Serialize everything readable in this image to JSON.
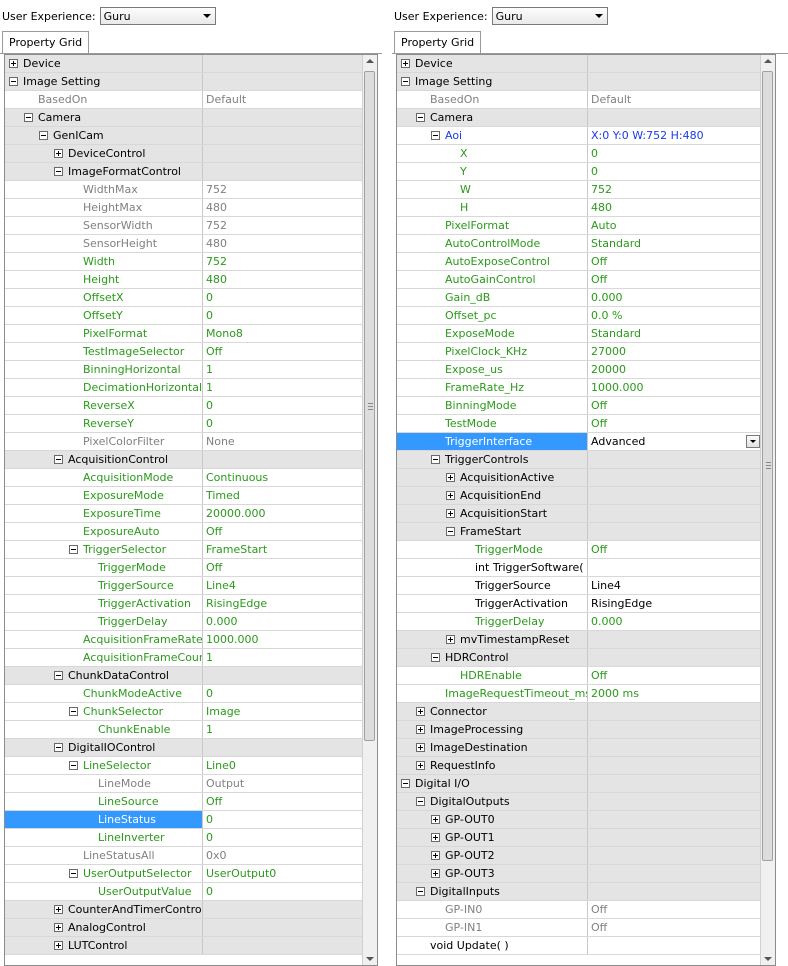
{
  "left": {
    "ux_label": "User Experience:",
    "ux_value": "Guru",
    "tab": "Property Grid",
    "rows": [
      {
        "depth": 0,
        "exp": "plus",
        "label": "Device",
        "value": "",
        "color": "black",
        "cat": true
      },
      {
        "depth": 0,
        "exp": "minus",
        "label": "Image Setting",
        "value": "",
        "color": "black",
        "cat": true
      },
      {
        "depth": 1,
        "exp": "none",
        "label": "BasedOn",
        "value": "Default",
        "color": "gray"
      },
      {
        "depth": 1,
        "exp": "minus",
        "label": "Camera",
        "value": "",
        "color": "black",
        "cat": true
      },
      {
        "depth": 2,
        "exp": "minus",
        "label": "GenICam",
        "value": "",
        "color": "black",
        "cat": true
      },
      {
        "depth": 3,
        "exp": "plus",
        "label": "DeviceControl",
        "value": "",
        "color": "black",
        "cat": true
      },
      {
        "depth": 3,
        "exp": "minus",
        "label": "ImageFormatControl",
        "value": "",
        "color": "black",
        "cat": true
      },
      {
        "depth": 4,
        "exp": "none",
        "label": "WidthMax",
        "value": "752",
        "color": "gray"
      },
      {
        "depth": 4,
        "exp": "none",
        "label": "HeightMax",
        "value": "480",
        "color": "gray"
      },
      {
        "depth": 4,
        "exp": "none",
        "label": "SensorWidth",
        "value": "752",
        "color": "gray"
      },
      {
        "depth": 4,
        "exp": "none",
        "label": "SensorHeight",
        "value": "480",
        "color": "gray"
      },
      {
        "depth": 4,
        "exp": "none",
        "label": "Width",
        "value": "752",
        "color": "green"
      },
      {
        "depth": 4,
        "exp": "none",
        "label": "Height",
        "value": "480",
        "color": "green"
      },
      {
        "depth": 4,
        "exp": "none",
        "label": "OffsetX",
        "value": "0",
        "color": "green"
      },
      {
        "depth": 4,
        "exp": "none",
        "label": "OffsetY",
        "value": "0",
        "color": "green"
      },
      {
        "depth": 4,
        "exp": "none",
        "label": "PixelFormat",
        "value": "Mono8",
        "color": "green"
      },
      {
        "depth": 4,
        "exp": "none",
        "label": "TestImageSelector",
        "value": "Off",
        "color": "green"
      },
      {
        "depth": 4,
        "exp": "none",
        "label": "BinningHorizontal",
        "value": "1",
        "color": "green"
      },
      {
        "depth": 4,
        "exp": "none",
        "label": "DecimationHorizontal",
        "value": "1",
        "color": "green"
      },
      {
        "depth": 4,
        "exp": "none",
        "label": "ReverseX",
        "value": "0",
        "color": "green"
      },
      {
        "depth": 4,
        "exp": "none",
        "label": "ReverseY",
        "value": "0",
        "color": "green"
      },
      {
        "depth": 4,
        "exp": "none",
        "label": "PixelColorFilter",
        "value": "None",
        "color": "gray"
      },
      {
        "depth": 3,
        "exp": "minus",
        "label": "AcquisitionControl",
        "value": "",
        "color": "black",
        "cat": true
      },
      {
        "depth": 4,
        "exp": "none",
        "label": "AcquisitionMode",
        "value": "Continuous",
        "color": "green"
      },
      {
        "depth": 4,
        "exp": "none",
        "label": "ExposureMode",
        "value": "Timed",
        "color": "green"
      },
      {
        "depth": 4,
        "exp": "none",
        "label": "ExposureTime",
        "value": "20000.000",
        "color": "green"
      },
      {
        "depth": 4,
        "exp": "none",
        "label": "ExposureAuto",
        "value": "Off",
        "color": "green"
      },
      {
        "depth": 4,
        "exp": "minus",
        "label": "TriggerSelector",
        "value": "FrameStart",
        "color": "green"
      },
      {
        "depth": 5,
        "exp": "none",
        "label": "TriggerMode",
        "value": "Off",
        "color": "green"
      },
      {
        "depth": 5,
        "exp": "none",
        "label": "TriggerSource",
        "value": "Line4",
        "color": "green"
      },
      {
        "depth": 5,
        "exp": "none",
        "label": "TriggerActivation",
        "value": "RisingEdge",
        "color": "green"
      },
      {
        "depth": 5,
        "exp": "none",
        "label": "TriggerDelay",
        "value": "0.000",
        "color": "green"
      },
      {
        "depth": 4,
        "exp": "none",
        "label": "AcquisitionFrameRate",
        "value": "1000.000",
        "color": "green"
      },
      {
        "depth": 4,
        "exp": "none",
        "label": "AcquisitionFrameCount",
        "value": "1",
        "color": "green"
      },
      {
        "depth": 3,
        "exp": "minus",
        "label": "ChunkDataControl",
        "value": "",
        "color": "black",
        "cat": true
      },
      {
        "depth": 4,
        "exp": "none",
        "label": "ChunkModeActive",
        "value": "0",
        "color": "green"
      },
      {
        "depth": 4,
        "exp": "minus",
        "label": "ChunkSelector",
        "value": "Image",
        "color": "green"
      },
      {
        "depth": 5,
        "exp": "none",
        "label": "ChunkEnable",
        "value": "1",
        "color": "green"
      },
      {
        "depth": 3,
        "exp": "minus",
        "label": "DigitalIOControl",
        "value": "",
        "color": "black",
        "cat": true
      },
      {
        "depth": 4,
        "exp": "minus",
        "label": "LineSelector",
        "value": "Line0",
        "color": "green"
      },
      {
        "depth": 5,
        "exp": "none",
        "label": "LineMode",
        "value": "Output",
        "color": "gray"
      },
      {
        "depth": 5,
        "exp": "none",
        "label": "LineSource",
        "value": "Off",
        "color": "green"
      },
      {
        "depth": 5,
        "exp": "none",
        "label": "LineStatus",
        "value": "0",
        "color": "green",
        "selected": true
      },
      {
        "depth": 5,
        "exp": "none",
        "label": "LineInverter",
        "value": "0",
        "color": "green"
      },
      {
        "depth": 4,
        "exp": "none",
        "label": "LineStatusAll",
        "value": "0x0",
        "color": "gray"
      },
      {
        "depth": 4,
        "exp": "minus",
        "label": "UserOutputSelector",
        "value": "UserOutput0",
        "color": "green"
      },
      {
        "depth": 5,
        "exp": "none",
        "label": "UserOutputValue",
        "value": "0",
        "color": "green"
      },
      {
        "depth": 3,
        "exp": "plus",
        "label": "CounterAndTimerControl",
        "value": "",
        "color": "black",
        "cat": true
      },
      {
        "depth": 3,
        "exp": "plus",
        "label": "AnalogControl",
        "value": "",
        "color": "black",
        "cat": true
      },
      {
        "depth": 3,
        "exp": "plus",
        "label": "LUTControl",
        "value": "",
        "color": "black",
        "cat": true
      }
    ]
  },
  "right": {
    "ux_label": "User Experience:",
    "ux_value": "Guru",
    "tab": "Property Grid",
    "rows": [
      {
        "depth": 0,
        "exp": "plus",
        "label": "Device",
        "value": "",
        "color": "black",
        "cat": true
      },
      {
        "depth": 0,
        "exp": "minus",
        "label": "Image Setting",
        "value": "",
        "color": "black",
        "cat": true
      },
      {
        "depth": 1,
        "exp": "none",
        "label": "BasedOn",
        "value": "Default",
        "color": "gray"
      },
      {
        "depth": 1,
        "exp": "minus",
        "label": "Camera",
        "value": "",
        "color": "black",
        "cat": true
      },
      {
        "depth": 2,
        "exp": "minus",
        "label": "Aoi",
        "value": "X:0 Y:0 W:752 H:480",
        "color": "blue"
      },
      {
        "depth": 3,
        "exp": "none",
        "label": "X",
        "value": "0",
        "color": "green"
      },
      {
        "depth": 3,
        "exp": "none",
        "label": "Y",
        "value": "0",
        "color": "green"
      },
      {
        "depth": 3,
        "exp": "none",
        "label": "W",
        "value": "752",
        "color": "green"
      },
      {
        "depth": 3,
        "exp": "none",
        "label": "H",
        "value": "480",
        "color": "green"
      },
      {
        "depth": 2,
        "exp": "none",
        "label": "PixelFormat",
        "value": "Auto",
        "color": "green"
      },
      {
        "depth": 2,
        "exp": "none",
        "label": "AutoControlMode",
        "value": "Standard",
        "color": "green"
      },
      {
        "depth": 2,
        "exp": "none",
        "label": "AutoExposeControl",
        "value": "Off",
        "color": "green"
      },
      {
        "depth": 2,
        "exp": "none",
        "label": "AutoGainControl",
        "value": "Off",
        "color": "green"
      },
      {
        "depth": 2,
        "exp": "none",
        "label": "Gain_dB",
        "value": "0.000",
        "color": "green"
      },
      {
        "depth": 2,
        "exp": "none",
        "label": "Offset_pc",
        "value": "0.0 %",
        "color": "green"
      },
      {
        "depth": 2,
        "exp": "none",
        "label": "ExposeMode",
        "value": "Standard",
        "color": "green"
      },
      {
        "depth": 2,
        "exp": "none",
        "label": "PixelClock_KHz",
        "value": "27000",
        "color": "green"
      },
      {
        "depth": 2,
        "exp": "none",
        "label": "Expose_us",
        "value": "20000",
        "color": "green"
      },
      {
        "depth": 2,
        "exp": "none",
        "label": "FrameRate_Hz",
        "value": "1000.000",
        "color": "green"
      },
      {
        "depth": 2,
        "exp": "none",
        "label": "BinningMode",
        "value": "Off",
        "color": "green"
      },
      {
        "depth": 2,
        "exp": "none",
        "label": "TestMode",
        "value": "Off",
        "color": "green"
      },
      {
        "depth": 2,
        "exp": "none",
        "label": "TriggerInterface",
        "value": "Advanced",
        "color": "green",
        "selected": true,
        "dropdown": true
      },
      {
        "depth": 2,
        "exp": "minus",
        "label": "TriggerControls",
        "value": "",
        "color": "black",
        "cat": true
      },
      {
        "depth": 3,
        "exp": "plus",
        "label": "AcquisitionActive",
        "value": "",
        "color": "black",
        "cat": true
      },
      {
        "depth": 3,
        "exp": "plus",
        "label": "AcquisitionEnd",
        "value": "",
        "color": "black",
        "cat": true
      },
      {
        "depth": 3,
        "exp": "plus",
        "label": "AcquisitionStart",
        "value": "",
        "color": "black",
        "cat": true
      },
      {
        "depth": 3,
        "exp": "minus",
        "label": "FrameStart",
        "value": "",
        "color": "black",
        "cat": true
      },
      {
        "depth": 4,
        "exp": "none",
        "label": "TriggerMode",
        "value": "Off",
        "color": "green"
      },
      {
        "depth": 4,
        "exp": "none",
        "label": "int TriggerSoftware( )",
        "value": "",
        "color": "black"
      },
      {
        "depth": 4,
        "exp": "none",
        "label": "TriggerSource",
        "value": "Line4",
        "color": "black"
      },
      {
        "depth": 4,
        "exp": "none",
        "label": "TriggerActivation",
        "value": "RisingEdge",
        "color": "black"
      },
      {
        "depth": 4,
        "exp": "none",
        "label": "TriggerDelay",
        "value": "0.000",
        "color": "green"
      },
      {
        "depth": 3,
        "exp": "plus",
        "label": "mvTimestampReset",
        "value": "",
        "color": "black",
        "cat": true
      },
      {
        "depth": 2,
        "exp": "minus",
        "label": "HDRControl",
        "value": "",
        "color": "black",
        "cat": true
      },
      {
        "depth": 3,
        "exp": "none",
        "label": "HDREnable",
        "value": "Off",
        "color": "green"
      },
      {
        "depth": 2,
        "exp": "none",
        "label": "ImageRequestTimeout_ms",
        "value": "2000 ms",
        "color": "green"
      },
      {
        "depth": 1,
        "exp": "plus",
        "label": "Connector",
        "value": "",
        "color": "black",
        "cat": true
      },
      {
        "depth": 1,
        "exp": "plus",
        "label": "ImageProcessing",
        "value": "",
        "color": "black",
        "cat": true
      },
      {
        "depth": 1,
        "exp": "plus",
        "label": "ImageDestination",
        "value": "",
        "color": "black",
        "cat": true
      },
      {
        "depth": 1,
        "exp": "plus",
        "label": "RequestInfo",
        "value": "",
        "color": "black",
        "cat": true
      },
      {
        "depth": 0,
        "exp": "minus",
        "label": "Digital I/O",
        "value": "",
        "color": "black",
        "cat": true
      },
      {
        "depth": 1,
        "exp": "minus",
        "label": "DigitalOutputs",
        "value": "",
        "color": "black",
        "cat": true
      },
      {
        "depth": 2,
        "exp": "plus",
        "label": "GP-OUT0",
        "value": "",
        "color": "black",
        "cat": true
      },
      {
        "depth": 2,
        "exp": "plus",
        "label": "GP-OUT1",
        "value": "",
        "color": "black",
        "cat": true
      },
      {
        "depth": 2,
        "exp": "plus",
        "label": "GP-OUT2",
        "value": "",
        "color": "black",
        "cat": true
      },
      {
        "depth": 2,
        "exp": "plus",
        "label": "GP-OUT3",
        "value": "",
        "color": "black",
        "cat": true
      },
      {
        "depth": 1,
        "exp": "minus",
        "label": "DigitalInputs",
        "value": "",
        "color": "black",
        "cat": true
      },
      {
        "depth": 2,
        "exp": "none",
        "label": "GP-IN0",
        "value": "Off",
        "color": "gray"
      },
      {
        "depth": 2,
        "exp": "none",
        "label": "GP-IN1",
        "value": "Off",
        "color": "gray"
      },
      {
        "depth": 1,
        "exp": "none",
        "label": "void Update( )",
        "value": "",
        "color": "black"
      }
    ]
  }
}
